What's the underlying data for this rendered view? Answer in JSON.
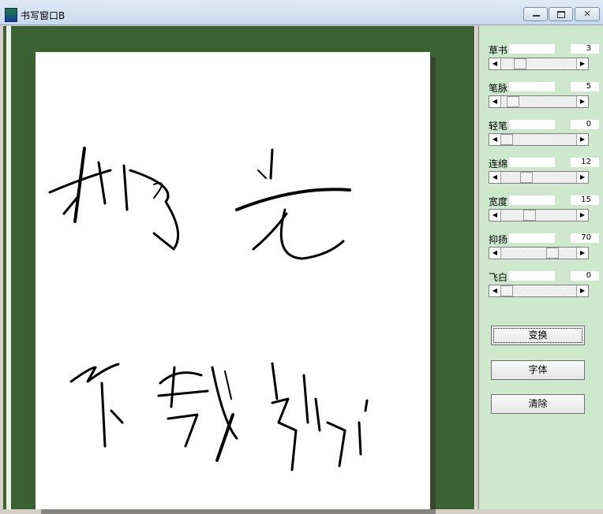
{
  "window": {
    "title": "书写窗口B",
    "icon": "calligraphy-app-icon"
  },
  "window_controls": {
    "minimize": "minimize-icon",
    "maximize": "maximize-icon",
    "close": "close-icon"
  },
  "canvas": {
    "background_color": "#3b6132",
    "paper_color": "#ffffff",
    "content": "handwritten-calligraphy"
  },
  "params": [
    {
      "label": "草书",
      "value": "3",
      "level": 0.2
    },
    {
      "label": "笔脉",
      "value": "5",
      "level": 0.1
    },
    {
      "label": "轻笔",
      "value": "0",
      "level": 0.0
    },
    {
      "label": "连绵",
      "value": "12",
      "level": 0.3
    },
    {
      "label": "宽度",
      "value": "15",
      "level": 0.35
    },
    {
      "label": "抑扬",
      "value": "70",
      "level": 0.7
    },
    {
      "label": "飞白",
      "value": "0",
      "level": 0.0
    }
  ],
  "buttons": {
    "transform": "变换",
    "font": "字体",
    "clear": "清除"
  },
  "colors": {
    "panel": "#cde8cd",
    "canvas": "#3b6132"
  }
}
